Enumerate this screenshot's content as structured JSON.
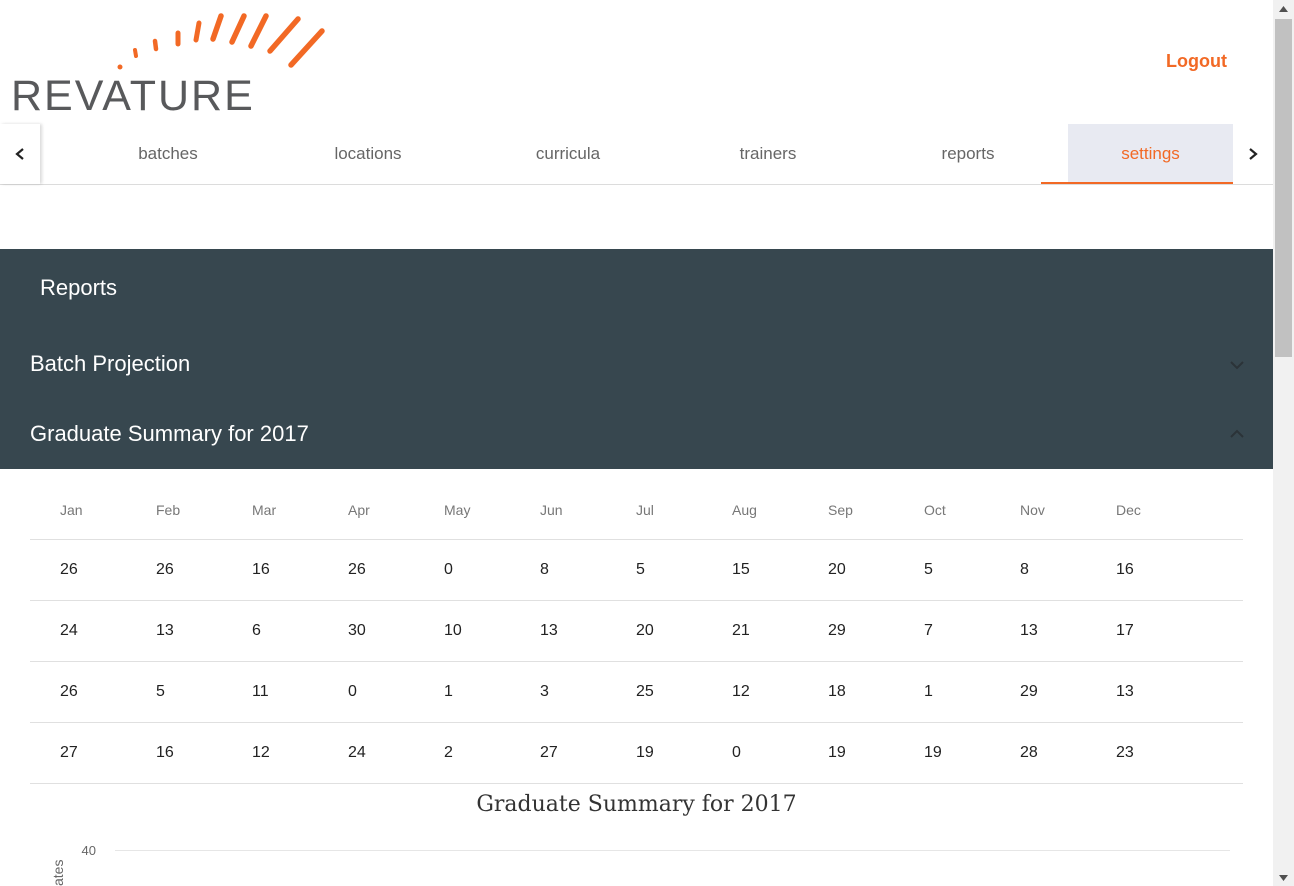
{
  "header": {
    "logo_text": "REVATURE",
    "logout_label": "Logout"
  },
  "tabs": [
    {
      "label": "batches"
    },
    {
      "label": "locations"
    },
    {
      "label": "curricula"
    },
    {
      "label": "trainers"
    },
    {
      "label": "reports"
    },
    {
      "label": "settings",
      "active": true
    }
  ],
  "panel": {
    "title": "Reports",
    "sections": [
      {
        "label": "Batch Projection",
        "expanded": false,
        "icon": "chevron-down-icon"
      },
      {
        "label": "Graduate Summary for 2017",
        "expanded": true,
        "icon": "chevron-up-icon"
      }
    ]
  },
  "table": {
    "headers": [
      "Jan",
      "Feb",
      "Mar",
      "Apr",
      "May",
      "Jun",
      "Jul",
      "Aug",
      "Sep",
      "Oct",
      "Nov",
      "Dec"
    ],
    "rows": [
      [
        "26",
        "26",
        "16",
        "26",
        "0",
        "8",
        "5",
        "15",
        "20",
        "5",
        "8",
        "16"
      ],
      [
        "24",
        "13",
        "6",
        "30",
        "10",
        "13",
        "20",
        "21",
        "29",
        "7",
        "13",
        "17"
      ],
      [
        "26",
        "5",
        "11",
        "0",
        "1",
        "3",
        "25",
        "12",
        "18",
        "1",
        "29",
        "13"
      ],
      [
        "27",
        "16",
        "12",
        "24",
        "2",
        "27",
        "19",
        "0",
        "19",
        "19",
        "28",
        "23"
      ]
    ]
  },
  "chart_data": {
    "type": "bar",
    "title": "Graduate Summary for 2017",
    "ylabel": "ates",
    "yticks_visible": [
      "40"
    ]
  },
  "colors": {
    "accent": "#f26925",
    "panel_bg": "#37474f",
    "active_tab_bg": "#e8eaf2",
    "logo_gray": "#58595b"
  }
}
